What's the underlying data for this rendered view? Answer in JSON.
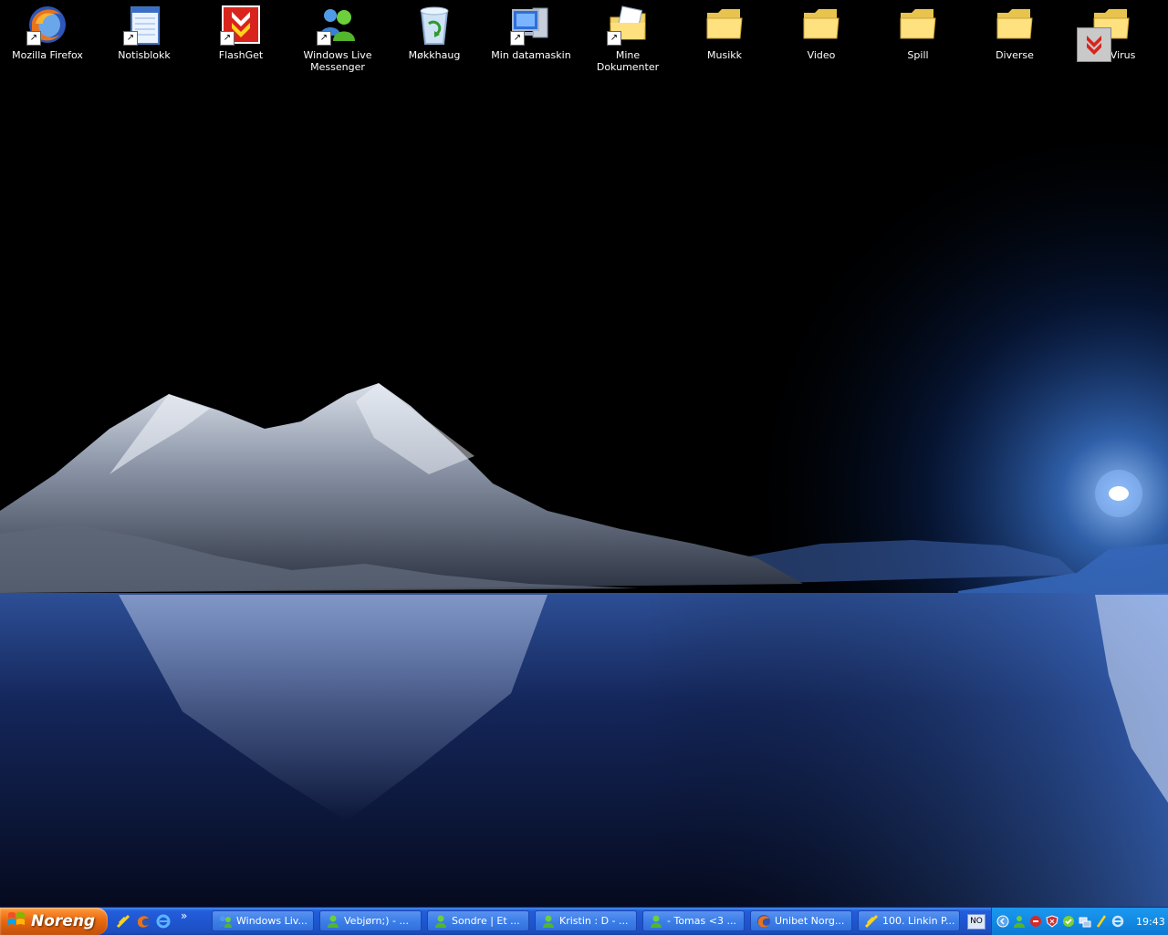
{
  "desktop": {
    "icons": [
      {
        "label": "Mozilla Firefox",
        "icon": "firefox-icon",
        "shortcut": true
      },
      {
        "label": "Notisblokk",
        "icon": "notepad-icon",
        "shortcut": true
      },
      {
        "label": "FlashGet",
        "icon": "flashget-icon",
        "shortcut": true
      },
      {
        "label": "Windows Live\nMessenger",
        "icon": "messenger-icon",
        "shortcut": true
      },
      {
        "label": "Møkkhaug",
        "icon": "recycle-bin-icon",
        "shortcut": false
      },
      {
        "label": "Min datamaskin",
        "icon": "my-computer-icon",
        "shortcut": true
      },
      {
        "label": "Mine Dokumenter",
        "icon": "my-documents-icon",
        "shortcut": true
      },
      {
        "label": "Musikk",
        "icon": "folder-icon",
        "shortcut": false
      },
      {
        "label": "Video",
        "icon": "folder-icon",
        "shortcut": false
      },
      {
        "label": "Spill",
        "icon": "folder-icon",
        "shortcut": false
      },
      {
        "label": "Diverse",
        "icon": "folder-icon",
        "shortcut": false
      },
      {
        "label": "Anti-Virus",
        "icon": "folder-icon",
        "shortcut": false
      }
    ]
  },
  "taskbar": {
    "start_label": "Noreng",
    "quicklaunch": [
      "flashget-icon",
      "firefox-icon",
      "ie-icon"
    ],
    "quicklaunch_more": "»",
    "tasks": [
      {
        "label": "Windows Liv...",
        "icon": "messenger-icon"
      },
      {
        "label": "Vebjørn;) - ...",
        "icon": "chat-icon"
      },
      {
        "label": "Sondre | Et ...",
        "icon": "chat-icon"
      },
      {
        "label": "Kristin : D - ...",
        "icon": "chat-icon"
      },
      {
        "label": "- Tomas  <3 ...",
        "icon": "chat-icon"
      },
      {
        "label": "Unibet Norg...",
        "icon": "firefox-icon"
      },
      {
        "label": "100. Linkin P...",
        "icon": "flashget-icon"
      }
    ],
    "language": "NO",
    "tray_icons": [
      "chevron-left-icon",
      "messenger-status-icon",
      "antivirus-icon",
      "shield-icon",
      "update-icon",
      "network-icon",
      "flashget-tray-icon",
      "ie-tray-icon"
    ],
    "clock": "19:43"
  },
  "colors": {
    "taskbar_blue": "#245edb",
    "start_orange": "#e96a10",
    "tray_blue": "#128ae4"
  }
}
